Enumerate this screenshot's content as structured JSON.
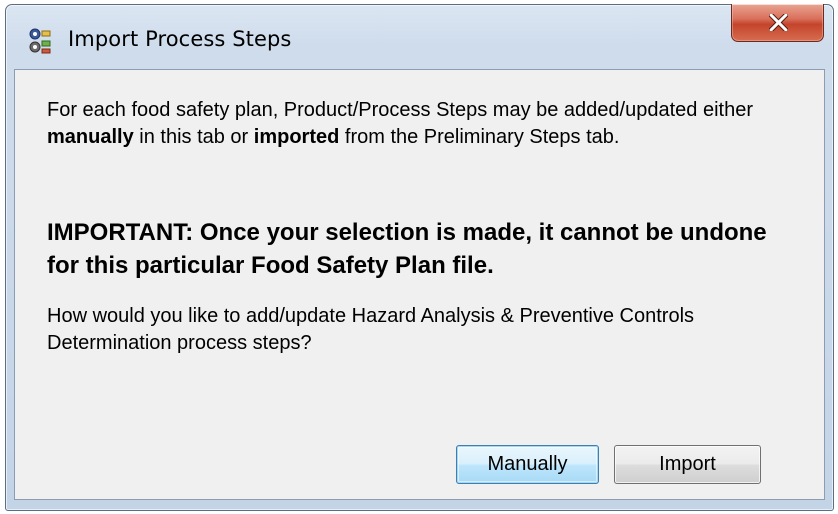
{
  "window": {
    "title": "Import Process Steps",
    "icon": "app-steps-icon",
    "close_glyph": "X"
  },
  "message": {
    "p1": {
      "part1": "For each food safety plan, Product/Process Steps may be added/updated either ",
      "bold1": "manually",
      "part2": " in this tab or ",
      "bold2": "imported",
      "part3": " from the Preliminary Steps tab."
    },
    "important": "IMPORTANT: Once your selection is made, it cannot be undone for this particular Food Safety Plan file.",
    "question": "How would you like to add/update Hazard Analysis & Preventive Controls Determination process steps?"
  },
  "buttons": {
    "manually": "Manually",
    "import": "Import"
  },
  "colors": {
    "client_bg": "#f0f0f0",
    "close_red": "#c4442b",
    "default_button_border": "#3c7fb1"
  }
}
